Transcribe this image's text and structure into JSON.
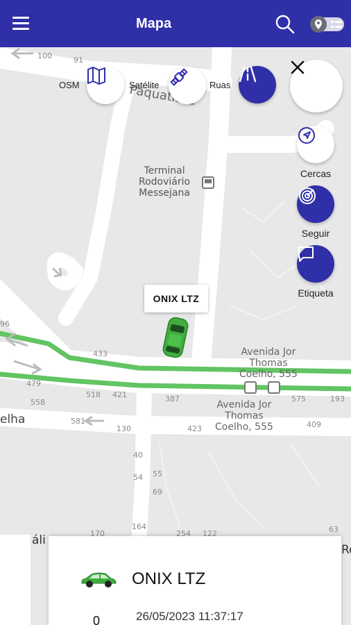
{
  "header": {
    "title": "Mapa",
    "menu_icon": "hamburger-icon",
    "search_icon": "search-icon",
    "toggle_icon": "location-list-toggle-icon"
  },
  "map": {
    "layers": {
      "osm": "OSM",
      "satellite": "Satélite",
      "streets": "Ruas"
    },
    "places": {
      "terminal": [
        "Terminal",
        "Rodoviário",
        "Messejana"
      ],
      "avenue_upper": [
        "Avenida Jor",
        "Thomas",
        "Coelho, 555"
      ],
      "avenue_lower": [
        "Avenida Jor",
        "Thomas",
        "Coelho, 555"
      ],
      "street_top": "Paquatiara",
      "street_left": "elha",
      "bottom_left_partial": "áli",
      "bottom_right_partial": "Ro"
    },
    "numbers": [
      "100",
      "91",
      "433",
      "518",
      "421",
      "387",
      "575",
      "193",
      "558",
      "479",
      "130",
      "423",
      "409",
      "40",
      "54",
      "55",
      "69",
      "164",
      "170",
      "254",
      "122",
      "63",
      "581",
      "96"
    ],
    "actions": {
      "fences": "Cercas",
      "follow": "Seguir",
      "label": "Etiqueta"
    },
    "colors": {
      "route": "#62c462",
      "primary": "#2f2fa8",
      "car": "#3fae3f"
    }
  },
  "vehicle": {
    "tooltip": "ONIX LTZ"
  },
  "card": {
    "name": "ONIX LTZ",
    "datetime": "26/05/2023 11:37:17",
    "value": "0"
  }
}
